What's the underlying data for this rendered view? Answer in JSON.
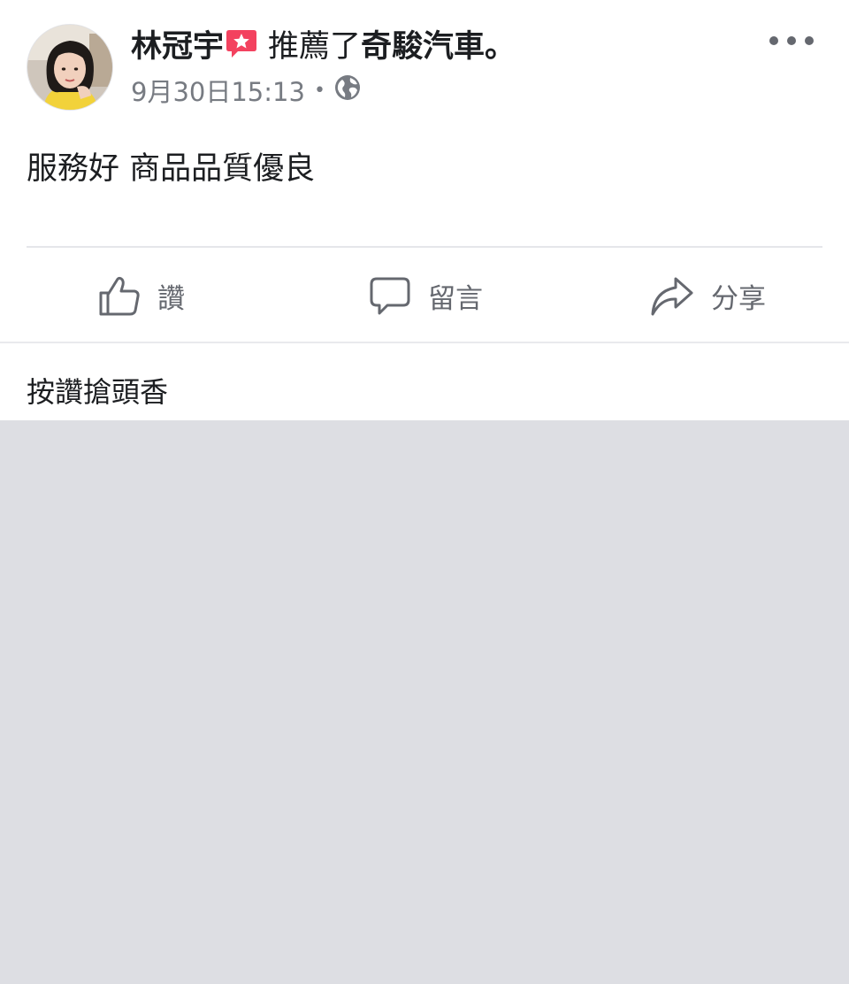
{
  "post": {
    "author": "林冠宇",
    "action": "推薦了",
    "page": "奇駿汽車",
    "period": "。",
    "timestamp": "9月30日15:13",
    "separator": "•",
    "privacy_icon": "globe-icon",
    "recommend_icon": "recommend-star-icon",
    "text": "服務好 商品品質優良"
  },
  "actions": {
    "like": "讚",
    "comment": "留言",
    "share": "分享"
  },
  "reactions": {
    "first_like_prompt": "按讚搶頭香"
  },
  "colors": {
    "accent_recommend": "#f3425f",
    "secondary_text": "#65686f",
    "background": "#dddee3"
  }
}
